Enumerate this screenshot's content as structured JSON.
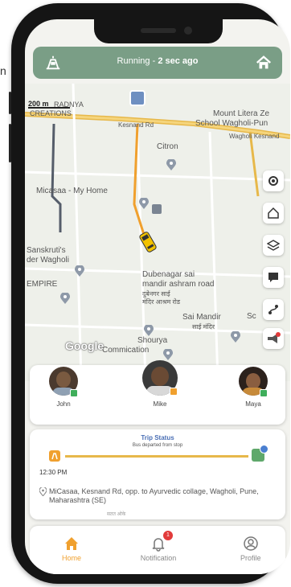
{
  "outside_text": "n",
  "header": {
    "status_prefix": "Running - ",
    "status_time": "2 sec ago"
  },
  "map": {
    "scale": "200 m",
    "labels": [
      "RADNYA",
      "CREATIONS",
      "Mount Litera Ze",
      "School Wagholi-Pun",
      "Kesnand Rd",
      "Wagholi Kesnand",
      "Citron",
      "Micasaa - My Home",
      "Sanskruti's",
      "der Wagholi",
      "EMPIRE",
      "Dubenagar sai",
      "mandir ashram road",
      "दुबेनगर साई",
      "मंदिर आश्रम रोड",
      "Sai Mandir",
      "साई मंदिर",
      "Shourya",
      "Commication",
      "Sc"
    ],
    "google_label": "Google"
  },
  "people": [
    {
      "name": "John",
      "status_color": "#3fae5b"
    },
    {
      "name": "Mike",
      "status_color": "#f0a02e"
    },
    {
      "name": "Maya",
      "status_color": "#3fae5b"
    }
  ],
  "trip": {
    "title": "Trip Status",
    "subtitle": "Bus departed from stop",
    "time": "12:30 PM",
    "address": "MiCasaa, Kesnand Rd, opp. to Ayurvedic collage, Wagholi, Pune, Maharashtra (SE)",
    "footer_fragment": "सतत ओके"
  },
  "nav": {
    "home": "Home",
    "notification": "Notification",
    "notification_count": "1",
    "profile": "Profile"
  },
  "colors": {
    "header_bg": "#7a9e86",
    "accent": "#f0a02e",
    "road_yellow": "#e7b84a",
    "badge": "#e23b3b"
  }
}
